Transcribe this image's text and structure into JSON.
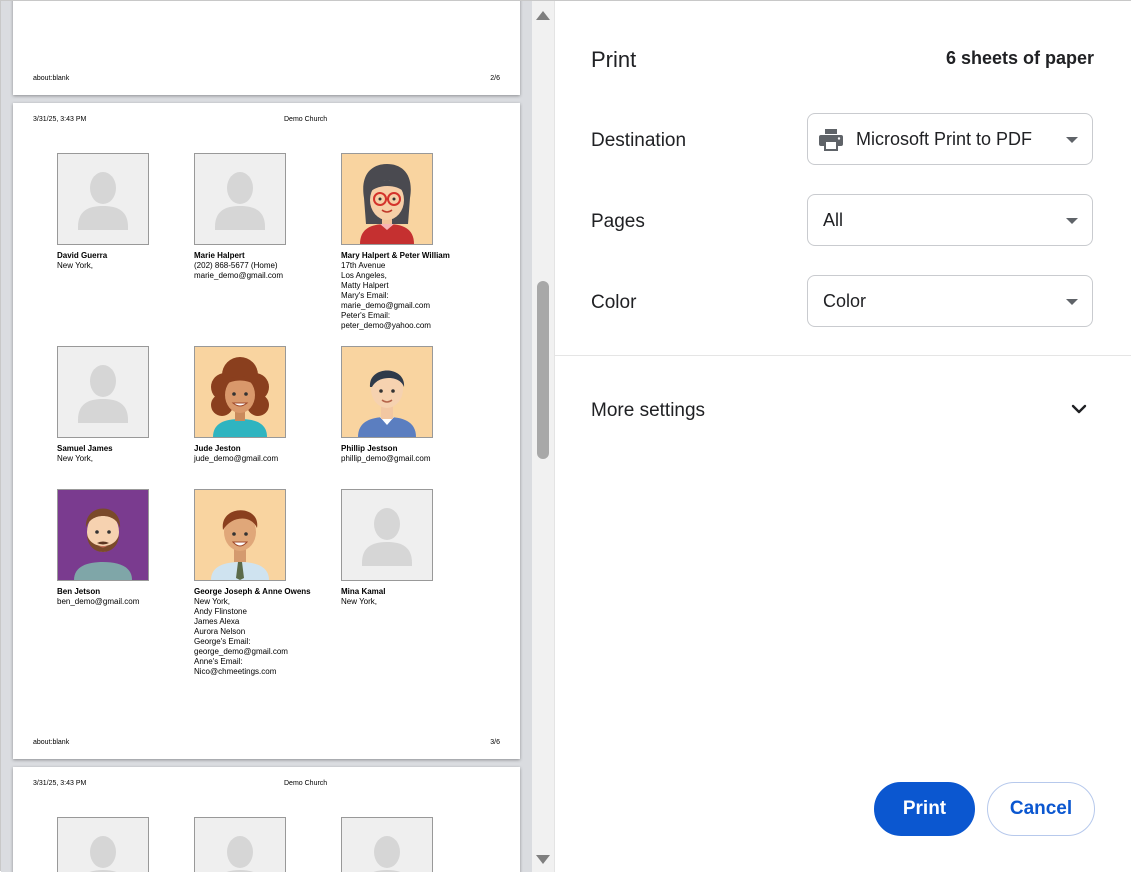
{
  "preview": {
    "page2": {
      "footer_left": "about:blank",
      "footer_right": "2/6"
    },
    "page3": {
      "header_left": "3/31/25, 3:43 PM",
      "header_center": "Demo Church",
      "footer_left": "about:blank",
      "footer_right": "3/6",
      "people": [
        {
          "name": "David Guerra",
          "lines": [
            "New York,"
          ],
          "photo": "placeholder-avatar"
        },
        {
          "name": "Marie Halpert",
          "lines": [
            "(202) 868-5677 (Home)",
            "marie_demo@gmail.com"
          ],
          "photo": "placeholder-avatar"
        },
        {
          "name": "Mary Halpert & Peter William",
          "lines": [
            "17th Avenue",
            "Los Angeles,",
            "Matty Halpert",
            "Mary's Email:",
            "marie_demo@gmail.com",
            "Peter's Email:",
            "peter_demo@yahoo.com"
          ],
          "photo": "woman-glasses-avatar"
        },
        {
          "name": "Samuel James",
          "lines": [
            "New York,"
          ],
          "photo": "placeholder-avatar"
        },
        {
          "name": "Jude Jeston",
          "lines": [
            "jude_demo@gmail.com"
          ],
          "photo": "woman-curly-avatar"
        },
        {
          "name": "Phillip Jestson",
          "lines": [
            "phillip_demo@gmail.com"
          ],
          "photo": "man-avatar"
        },
        {
          "name": "Ben Jetson",
          "lines": [
            "ben_demo@gmail.com"
          ],
          "photo": "bearded-man-avatar"
        },
        {
          "name": "George Joseph & Anne Owens",
          "lines": [
            "New York,",
            "Andy Flinstone",
            "James Alexa",
            "Aurora Nelson",
            "George's Email:",
            "george_demo@gmail.com",
            "Anne's Email:",
            "Nico@chmeetings.com"
          ],
          "photo": "man-tie-avatar"
        },
        {
          "name": "Mina Kamal",
          "lines": [
            "New York,"
          ],
          "photo": "placeholder-avatar"
        }
      ]
    },
    "page4": {
      "header_left": "3/31/25, 3:43 PM",
      "header_center": "Demo Church"
    }
  },
  "panel": {
    "title": "Print",
    "sheets": "6 sheets of paper",
    "destination": {
      "label": "Destination",
      "value": "Microsoft Print to PDF",
      "icon": "printer-icon"
    },
    "pages": {
      "label": "Pages",
      "value": "All"
    },
    "color": {
      "label": "Color",
      "value": "Color"
    },
    "more_settings": "More settings",
    "print_button": "Print",
    "cancel_button": "Cancel"
  },
  "colors": {
    "accent": "#0b57d0",
    "preview_bg": "#dadce0"
  }
}
